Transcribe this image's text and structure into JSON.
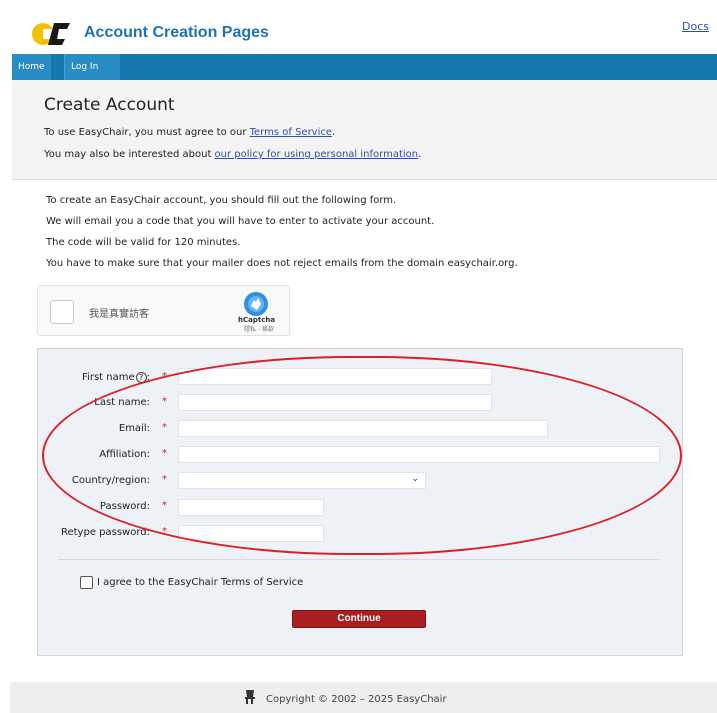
{
  "header": {
    "logo_icon": "easychair-logo-icon",
    "app_title": "Account Creation Pages",
    "docs_link": "Docs"
  },
  "nav": {
    "home": "Home",
    "login": "Log In"
  },
  "intro": {
    "page_title": "Create Account",
    "tos_prefix": "To use EasyChair, you must agree to our ",
    "tos_link": "Terms of Service",
    "tos_suffix": ".",
    "policy_prefix": "You may also be interested about ",
    "policy_link": "our policy for using personal information",
    "policy_suffix": "."
  },
  "info": {
    "line1": "To create an EasyChair account, you should fill out the following form.",
    "line2": "We will email you a code that you will have to enter to activate your account.",
    "line3": "The code will be valid for 120 minutes.",
    "line4": "You have to make sure that your mailer does not reject emails from the domain easychair.org."
  },
  "captcha": {
    "label": "我是真實訪客",
    "brand": "hCaptcha",
    "sub": "隱私 - 條款"
  },
  "form": {
    "required_mark": "*",
    "fields": [
      {
        "label": "First name",
        "help": "?",
        "suffix": ":",
        "value": ""
      },
      {
        "label": "Last name:",
        "value": ""
      },
      {
        "label": "Email:",
        "value": ""
      },
      {
        "label": "Affiliation:",
        "value": ""
      },
      {
        "label": "Country/region:",
        "value": ""
      },
      {
        "label": "Password:",
        "value": ""
      },
      {
        "label": "Retype password:",
        "value": ""
      }
    ],
    "agree_label": "I agree to the EasyChair Terms of Service",
    "continue_label": "Continue"
  },
  "footer": {
    "copyright": "Copyright © 2002 – 2025 EasyChair"
  },
  "colors": {
    "nav_bar": "#1778ad",
    "title_blue": "#1e73b3",
    "button_red": "#a91f1f",
    "highlight_red": "#d92128"
  }
}
